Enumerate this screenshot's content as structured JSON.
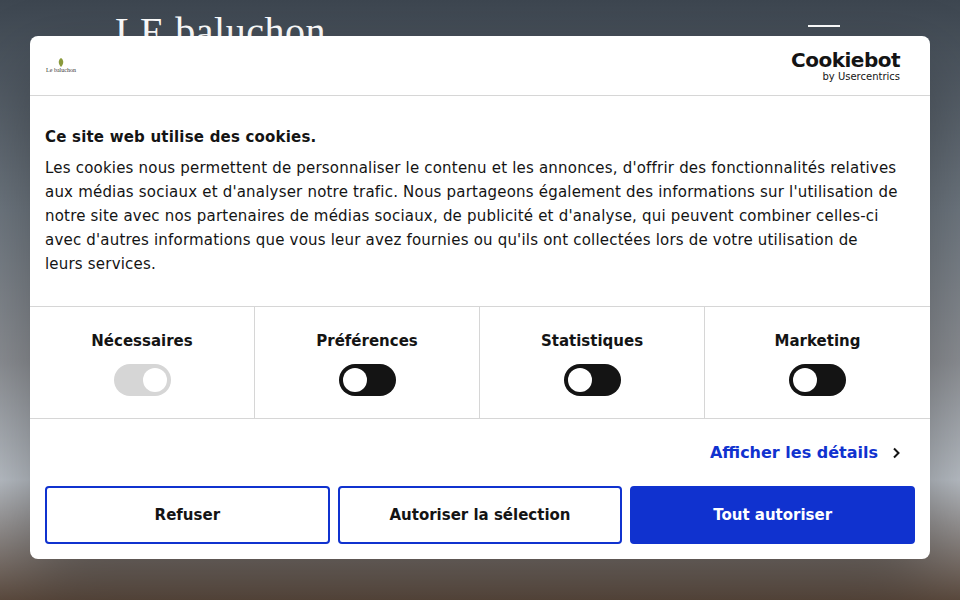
{
  "site": {
    "logo": "LE baluchon"
  },
  "dialog": {
    "brand_logo": "Le baluchon",
    "provider": {
      "name": "Cookiebot",
      "byline": "by Usercentrics"
    },
    "title": "Ce site web utilise des cookies.",
    "body": "Les cookies nous permettent de personnaliser le contenu et les annonces, d'offrir des fonctionnalités relatives aux médias sociaux et d'analyser notre trafic. Nous partageons également des informations sur l'utilisation de notre site avec nos partenaires de médias sociaux, de publicité et d'analyse, qui peuvent combiner celles-ci avec d'autres informations que vous leur avez fournies ou qu'ils ont collectées lors de votre utilisation de leurs services.",
    "categories": [
      {
        "label": "Nécessaires",
        "checked": true,
        "disabled": true
      },
      {
        "label": "Préférences",
        "checked": false,
        "disabled": false
      },
      {
        "label": "Statistiques",
        "checked": false,
        "disabled": false
      },
      {
        "label": "Marketing",
        "checked": false,
        "disabled": false
      }
    ],
    "details_link": "Afficher les détails",
    "buttons": [
      {
        "label": "Refuser",
        "kind": "outline"
      },
      {
        "label": "Autoriser la sélection",
        "kind": "outline"
      },
      {
        "label": "Tout autoriser",
        "kind": "primary"
      }
    ]
  }
}
